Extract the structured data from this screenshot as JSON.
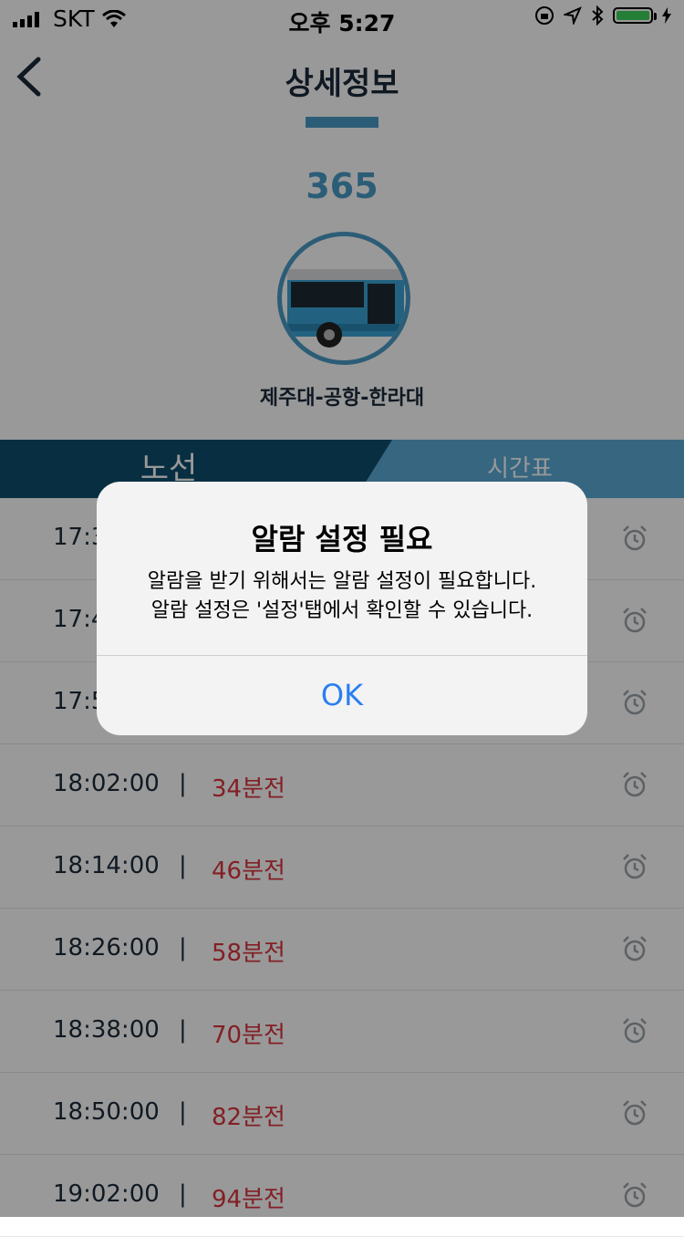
{
  "status_bar": {
    "carrier": "SKT",
    "time": "오후 5:27"
  },
  "nav": {
    "title": "상세정보"
  },
  "route": {
    "number": "365",
    "name": "제주대-공항-한라대"
  },
  "tabs": {
    "route_label": "노선",
    "timetable_label": "시간표"
  },
  "schedule": [
    {
      "time": "17:30:00",
      "sep": "|",
      "remain": ""
    },
    {
      "time": "17:40:00",
      "sep": "|",
      "remain": ""
    },
    {
      "time": "17:50:00",
      "sep": "|",
      "remain": ""
    },
    {
      "time": "18:02:00",
      "sep": "|",
      "remain": "34분전"
    },
    {
      "time": "18:14:00",
      "sep": "|",
      "remain": "46분전"
    },
    {
      "time": "18:26:00",
      "sep": "|",
      "remain": "58분전"
    },
    {
      "time": "18:38:00",
      "sep": "|",
      "remain": "70분전"
    },
    {
      "time": "18:50:00",
      "sep": "|",
      "remain": "82분전"
    },
    {
      "time": "19:02:00",
      "sep": "|",
      "remain": "94분전"
    }
  ],
  "alert": {
    "title": "알람 설정 필요",
    "message_line1": "알람을 받기 위해서는 알람 설정이 필요합니다.",
    "message_line2": "알람 설정은 '설정'탭에서 확인할 수 있습니다.",
    "ok_label": "OK"
  },
  "colors": {
    "accent": "#4a9cc7",
    "tab_dark": "#0e4d6e",
    "remain": "#d9363e",
    "ok": "#2a7ef0"
  },
  "icons": {
    "back": "chevron-left-icon",
    "alarm": "alarm-clock-icon",
    "bus": "bus-image"
  }
}
